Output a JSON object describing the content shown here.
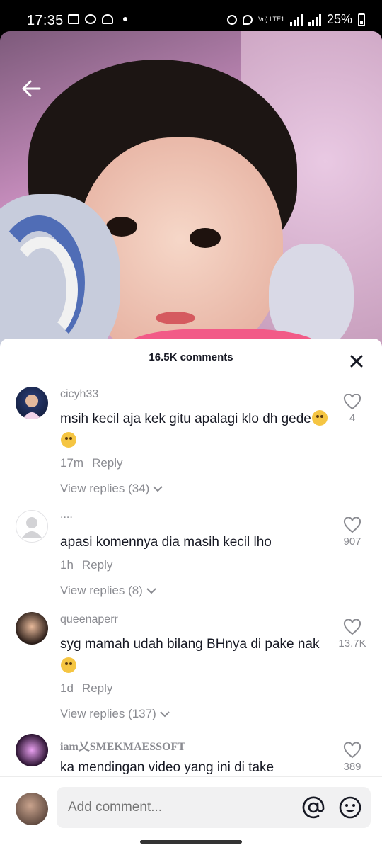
{
  "status_bar": {
    "time": "17:35",
    "network": "Vo) LTE1",
    "battery": "25%"
  },
  "video": {
    "back_icon": "arrow-left-icon"
  },
  "comments_panel": {
    "title": "16.5K comments",
    "close_icon": "close-icon"
  },
  "comments": [
    {
      "username": "cicyh33",
      "text": "msih kecil aja kek gitu apalagi klo dh gede",
      "emojis": [
        "flushed-face",
        "grinning-sweat-face"
      ],
      "time": "17m",
      "reply_label": "Reply",
      "view_replies": "View replies (34)",
      "likes": "4"
    },
    {
      "username": "....",
      "text": "apasi komennya dia masih kecil lho",
      "time": "1h",
      "reply_label": "Reply",
      "view_replies": "View replies (8)",
      "likes": "907"
    },
    {
      "username": "queenaperr",
      "text": "syg mamah udah bilang BHnya di pake nak",
      "emojis": [
        "pleading-face"
      ],
      "time": "1d",
      "reply_label": "Reply",
      "view_replies": "View replies (137)",
      "likes": "13.7K"
    },
    {
      "username": "iam乂SMEKMAESSOFT",
      "text": "ka mendingan video yang ini di take",
      "likes": "389"
    }
  ],
  "input_bar": {
    "placeholder": "Add comment...",
    "mention_icon": "at-sign-icon",
    "emoji_icon": "smiley-icon"
  }
}
